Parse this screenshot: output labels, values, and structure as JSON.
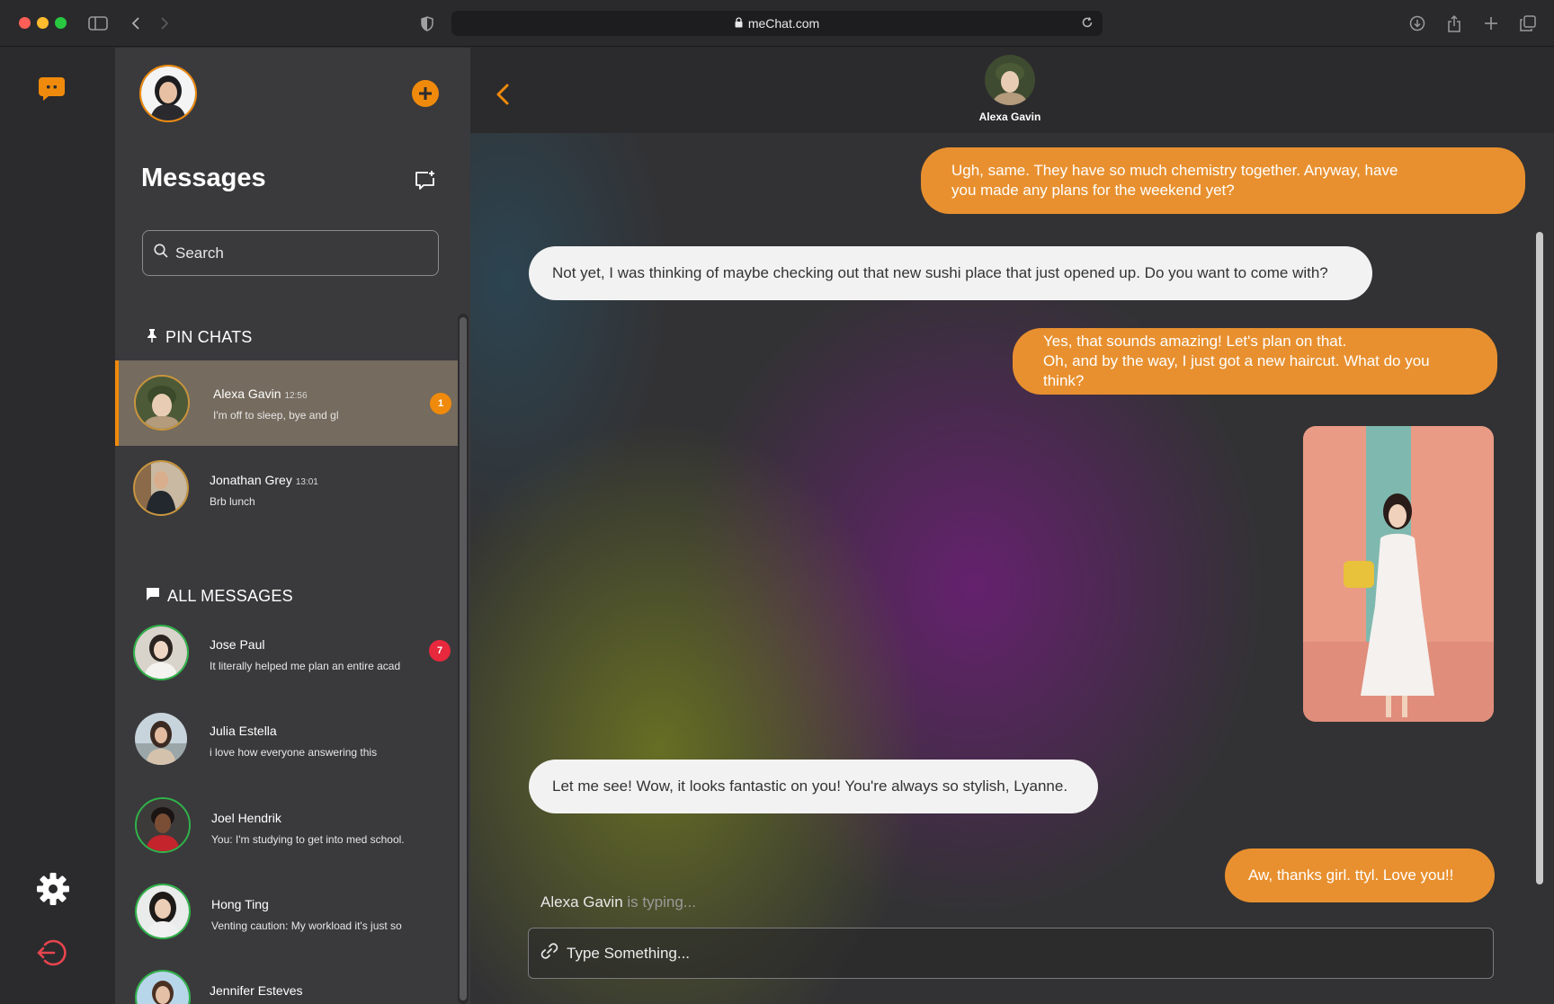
{
  "browser": {
    "url": "meChat.com"
  },
  "colors": {
    "accent": "#F08A0C",
    "bubble_out": "#E8902F",
    "bubble_in": "#F2F2F2",
    "badge_orange": "#F08A0C",
    "badge_red": "#E8283C",
    "online_ring": "#2FB44A",
    "logout": "#E8454E"
  },
  "rail": {
    "logo_icon": "chat-bubble-logo-icon",
    "settings_icon": "gear-icon",
    "logout_icon": "logout-icon"
  },
  "sidebar": {
    "title": "Messages",
    "search_placeholder": "Search",
    "pinned_heading": "PIN CHATS",
    "all_heading": "ALL MESSAGES",
    "pinned": [
      {
        "name": "Alexa Gavin",
        "time": "12:56",
        "preview": "I'm off to sleep, bye and gl",
        "badge": "1"
      },
      {
        "name": "Jonathan Grey",
        "time": "13:01",
        "preview": "Brb lunch"
      }
    ],
    "all": [
      {
        "name": "Jose Paul",
        "preview": "It literally helped me plan an entire acad",
        "badge": "7"
      },
      {
        "name": "Julia Estella",
        "preview": "i love how everyone answering this"
      },
      {
        "name": "Joel Hendrik",
        "preview": "You: I'm studying to get into med school."
      },
      {
        "name": "Hong Ting",
        "preview": "Venting caution: My workload it's just so"
      },
      {
        "name": "Jennifer Esteves",
        "preview": ""
      }
    ]
  },
  "chat": {
    "contact_name": "Alexa Gavin",
    "messages": [
      {
        "dir": "out",
        "lines": [
          "Ugh, same. They have so much chemistry together. Anyway, have",
          "you made any plans for the weekend yet?"
        ]
      },
      {
        "dir": "in",
        "lines": [
          "Not yet, I was thinking of maybe checking out that new sushi place that just opened up. Do you want to come with?"
        ]
      },
      {
        "dir": "out",
        "lines": [
          "Yes, that sounds amazing! Let's plan on that.",
          "Oh, and by the way, I just got a new haircut. What do you think?"
        ]
      },
      {
        "dir": "in",
        "lines": [
          "Let me see! Wow, it looks fantastic on you! You're always so stylish, Lyanne."
        ]
      },
      {
        "dir": "out",
        "lines": [
          "Aw, thanks girl. ttyl. Love you!!"
        ]
      }
    ],
    "typing_name": "Alexa Gavin",
    "typing_suffix": "is typing...",
    "composer_placeholder": "Type Something..."
  }
}
